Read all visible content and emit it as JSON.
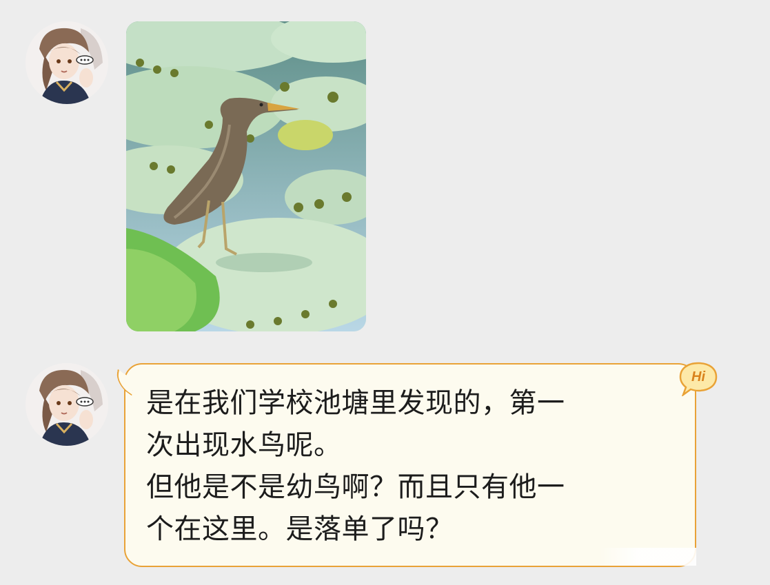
{
  "messages": [
    {
      "type": "image",
      "sender_avatar": "anime-character-avatar",
      "image_subject": "heron-on-lily-pads"
    },
    {
      "type": "text",
      "sender_avatar": "anime-character-avatar",
      "lines": [
        "是在我们学校池塘里发现的，第一",
        "次出现水鸟呢。",
        "但他是不是幼鸟啊？而且只有他一",
        "个在这里。是落单了吗？"
      ],
      "badge": "Hi"
    }
  ],
  "colors": {
    "background": "#ededed",
    "bubble_fill": "#fdfbef",
    "bubble_border": "#e9a236",
    "badge_text": "#d9821c"
  }
}
